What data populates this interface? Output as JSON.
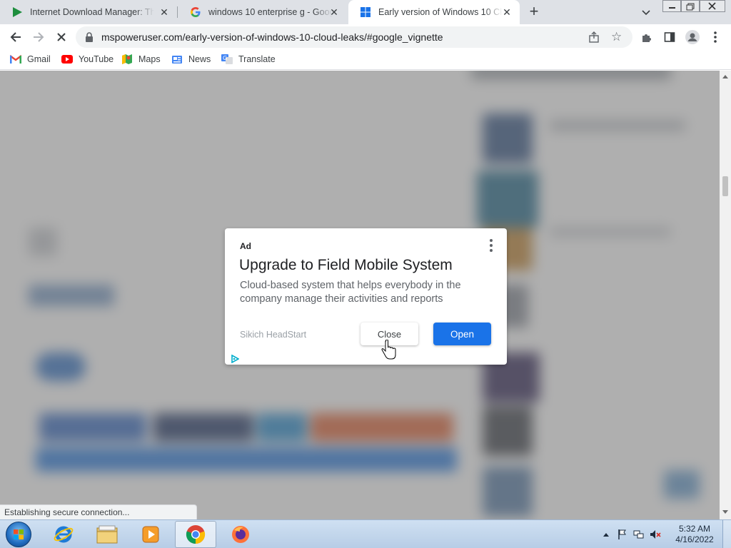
{
  "browser": {
    "tabs": [
      {
        "title": "Internet Download Manager: The",
        "favicon": "idm-play-icon",
        "active": false
      },
      {
        "title": "windows 10 enterprise g - Googl",
        "favicon": "google-g-icon",
        "active": false
      },
      {
        "title": "Early version of Windows 10 Clo",
        "favicon": "windows-logo-icon",
        "active": true
      }
    ],
    "address_bar": {
      "url": "mspoweruser.com/early-version-of-windows-10-cloud-leaks/#google_vignette"
    },
    "bookmarks": [
      {
        "label": "Gmail",
        "icon": "gmail-icon"
      },
      {
        "label": "YouTube",
        "icon": "youtube-icon"
      },
      {
        "label": "Maps",
        "icon": "maps-icon"
      },
      {
        "label": "News",
        "icon": "news-icon"
      },
      {
        "label": "Translate",
        "icon": "translate-icon"
      }
    ],
    "status_text": "Establishing secure connection..."
  },
  "ad": {
    "label": "Ad",
    "headline": "Upgrade to Field Mobile System",
    "description": "Cloud-based system that helps everybody in the company manage their activities and reports",
    "advertiser": "Sikich HeadStart",
    "close_label": "Close",
    "open_label": "Open",
    "accent_color": "#1a73e8"
  },
  "taskbar": {
    "apps": [
      "internet-explorer-icon",
      "file-explorer-icon",
      "media-player-icon",
      "chrome-icon",
      "firefox-icon"
    ],
    "active_app": "chrome-icon",
    "clock_time": "5:32 AM",
    "clock_date": "4/16/2022"
  }
}
